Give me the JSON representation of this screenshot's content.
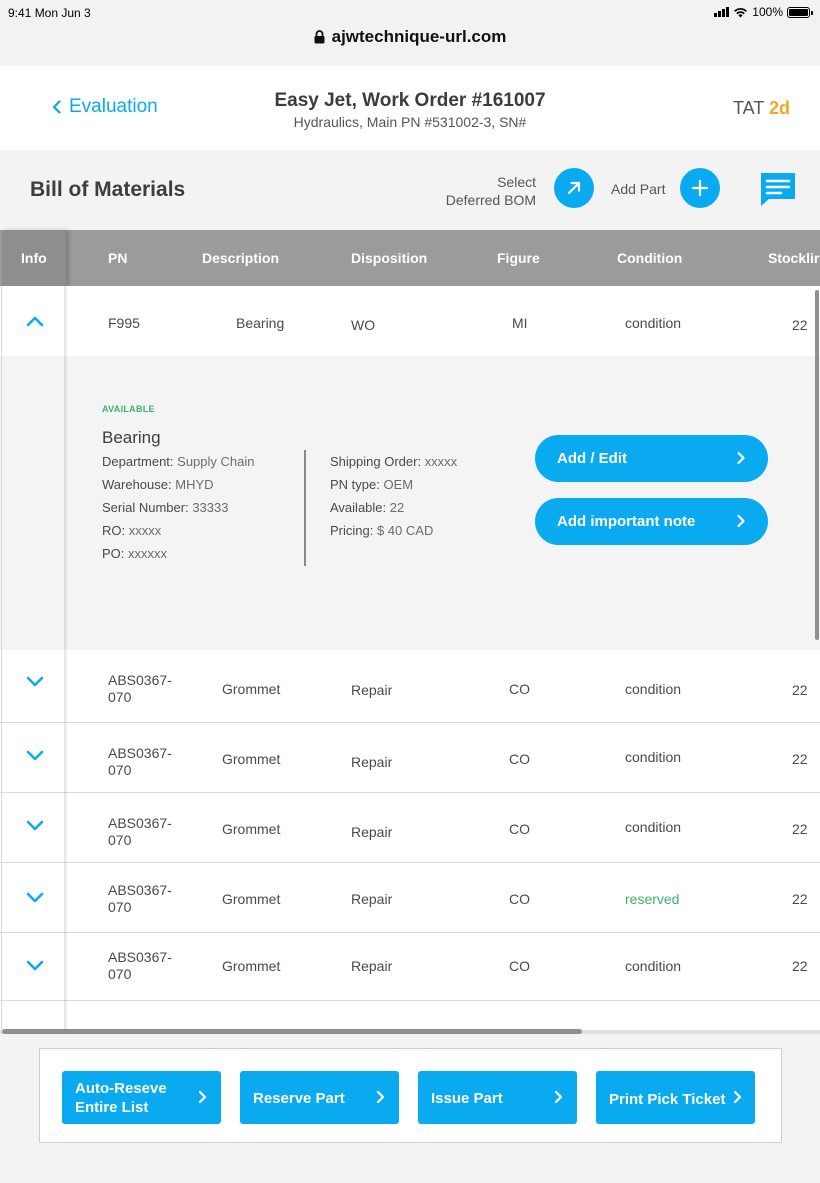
{
  "status_bar": {
    "time": "9:41  Mon Jun 3",
    "battery": "100%"
  },
  "browser": {
    "url": "ajwtechnique-url.com"
  },
  "header": {
    "back_label": "Evaluation",
    "title": "Easy Jet, Work Order #161007",
    "subtitle": "Hydraulics, Main PN #531002-3, SN#",
    "tat_label": "TAT",
    "tat_value": "2d"
  },
  "toolbar": {
    "section_title": "Bill of Materials",
    "deferred_line1": "Select",
    "deferred_line2": "Deferred BOM",
    "add_part_label": "Add Part"
  },
  "table": {
    "columns": [
      "Info",
      "PN",
      "Description",
      "Disposition",
      "Figure",
      "Condition",
      "Stocklir"
    ],
    "expanded_row": {
      "pn": "F995",
      "description": "Bearing",
      "disposition": "WO",
      "figure": "MI",
      "condition": "condition",
      "stock": "22"
    },
    "rows": [
      {
        "pn": "ABS0367-070",
        "description": "Grommet",
        "disposition": "Repair",
        "figure": "CO",
        "condition": "condition",
        "stock": "22"
      },
      {
        "pn": "ABS0367-070",
        "description": "Grommet",
        "disposition": "Repair",
        "figure": "CO",
        "condition": "condition",
        "stock": "22"
      },
      {
        "pn": "ABS0367-070",
        "description": "Grommet",
        "disposition": "Repair",
        "figure": "CO",
        "condition": "condition",
        "stock": "22"
      },
      {
        "pn": "ABS0367-070",
        "description": "Grommet",
        "disposition": "Repair",
        "figure": "CO",
        "condition": "reserved",
        "stock": "22"
      },
      {
        "pn": "ABS0367-070",
        "description": "Grommet",
        "disposition": "Repair",
        "figure": "CO",
        "condition": "condition",
        "stock": "22"
      }
    ]
  },
  "detail": {
    "availability": "AVAILABLE",
    "name": "Bearing",
    "left": [
      {
        "label": "Department: ",
        "value": "Supply Chain"
      },
      {
        "label": "Warehouse: ",
        "value": "MHYD"
      },
      {
        "label": "Serial Number: ",
        "value": "33333"
      },
      {
        "label": "RO: ",
        "value": "xxxxx"
      },
      {
        "label": "PO: ",
        "value": "xxxxxx"
      }
    ],
    "right": [
      {
        "label": "Shipping Order: ",
        "value": "xxxxx"
      },
      {
        "label": "PN type: ",
        "value": "OEM"
      },
      {
        "label": "Available: ",
        "value": "22"
      },
      {
        "label": "Pricing: ",
        "value": "$ 40 CAD"
      }
    ],
    "add_edit_label": "Add / Edit",
    "add_note_label": "Add important note"
  },
  "actions": {
    "auto_reserve_line1": "Auto-Reseve",
    "auto_reserve_line2": "Entire List",
    "reserve_part": "Reserve Part",
    "issue_part": "Issue Part",
    "print_pick_ticket": "Print Pick Ticket"
  },
  "colors": {
    "accent": "#0aaaf0",
    "tat": "#f5a623",
    "available": "#3bb36b",
    "header_gray": "#9b9b9b"
  }
}
